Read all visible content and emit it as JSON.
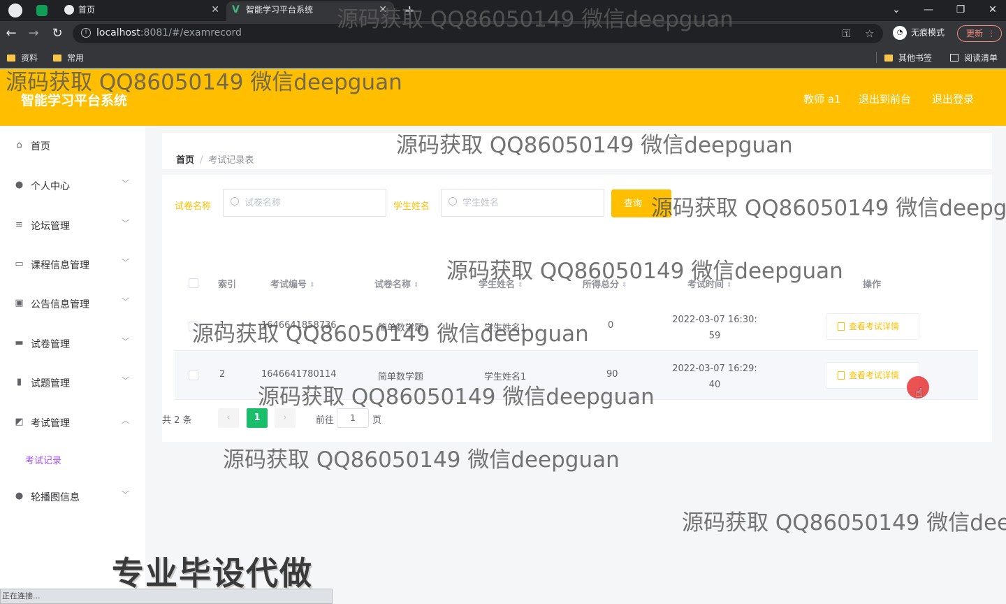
{
  "browser": {
    "tabs": [
      {
        "title": "首页",
        "active": false
      },
      {
        "title": "智能学习平台系统",
        "active": true
      }
    ],
    "url_host": "localhost",
    "url_path": ":8081/#/examrecord",
    "incognito_label": "无痕模式",
    "update_label": "更新",
    "bookmarks": [
      "资料",
      "常用"
    ],
    "bookmarks_right": [
      "其他书签",
      "阅读清单"
    ],
    "status_text": "正在连接..."
  },
  "header": {
    "title": "智能学习平台系统",
    "user": "教师 a1",
    "to_front": "退出到前台",
    "logout": "退出登录"
  },
  "sidebar": {
    "items": [
      {
        "label": "首页",
        "icon": "home-icon",
        "expandable": false
      },
      {
        "label": "个人中心",
        "icon": "user-icon",
        "expandable": true
      },
      {
        "label": "论坛管理",
        "icon": "sliders-icon",
        "expandable": true
      },
      {
        "label": "课程信息管理",
        "icon": "card-icon",
        "expandable": true
      },
      {
        "label": "公告信息管理",
        "icon": "clipboard-icon",
        "expandable": true
      },
      {
        "label": "试卷管理",
        "icon": "laptop-icon",
        "expandable": true
      },
      {
        "label": "试题管理",
        "icon": "bar-chart-icon",
        "expandable": true
      },
      {
        "label": "考试管理",
        "icon": "line-chart-icon",
        "expandable": true,
        "expanded": true
      },
      {
        "label": "轮播图信息",
        "icon": "user-icon",
        "expandable": true
      }
    ],
    "active_sub": "考试记录"
  },
  "breadcrumb": {
    "home": "首页",
    "current": "考试记录表"
  },
  "filters": {
    "paper_label": "试卷名称",
    "paper_placeholder": "试卷名称",
    "student_label": "学生姓名",
    "student_placeholder": "学生姓名",
    "query": "查询"
  },
  "table": {
    "columns": [
      "索引",
      "考试编号",
      "试卷名称",
      "学生姓名",
      "所得总分",
      "考试时间",
      "操作"
    ],
    "rows": [
      {
        "index": "1",
        "exam_no": "1646641858736",
        "paper": "简单数学题",
        "student": "学生姓名1",
        "score": "0",
        "time_a": "2022-03-07 16:30:",
        "time_b": "59",
        "action": "查看考试详情"
      },
      {
        "index": "2",
        "exam_no": "1646641780114",
        "paper": "简单数学题",
        "student": "学生姓名1",
        "score": "90",
        "time_a": "2022-03-07 16:29:",
        "time_b": "40",
        "action": "查看考试详情"
      }
    ]
  },
  "pagination": {
    "total": "共 2 条",
    "current": "1",
    "goto_label": "前往",
    "goto_value": "1",
    "page_unit": "页"
  },
  "watermark": "源码获取 QQ86050149 微信deepguan",
  "banner": "专业毕设代做",
  "colors": {
    "accent": "#ffbf00",
    "active_page": "#19be6b",
    "submenu_active": "#a64dff"
  }
}
